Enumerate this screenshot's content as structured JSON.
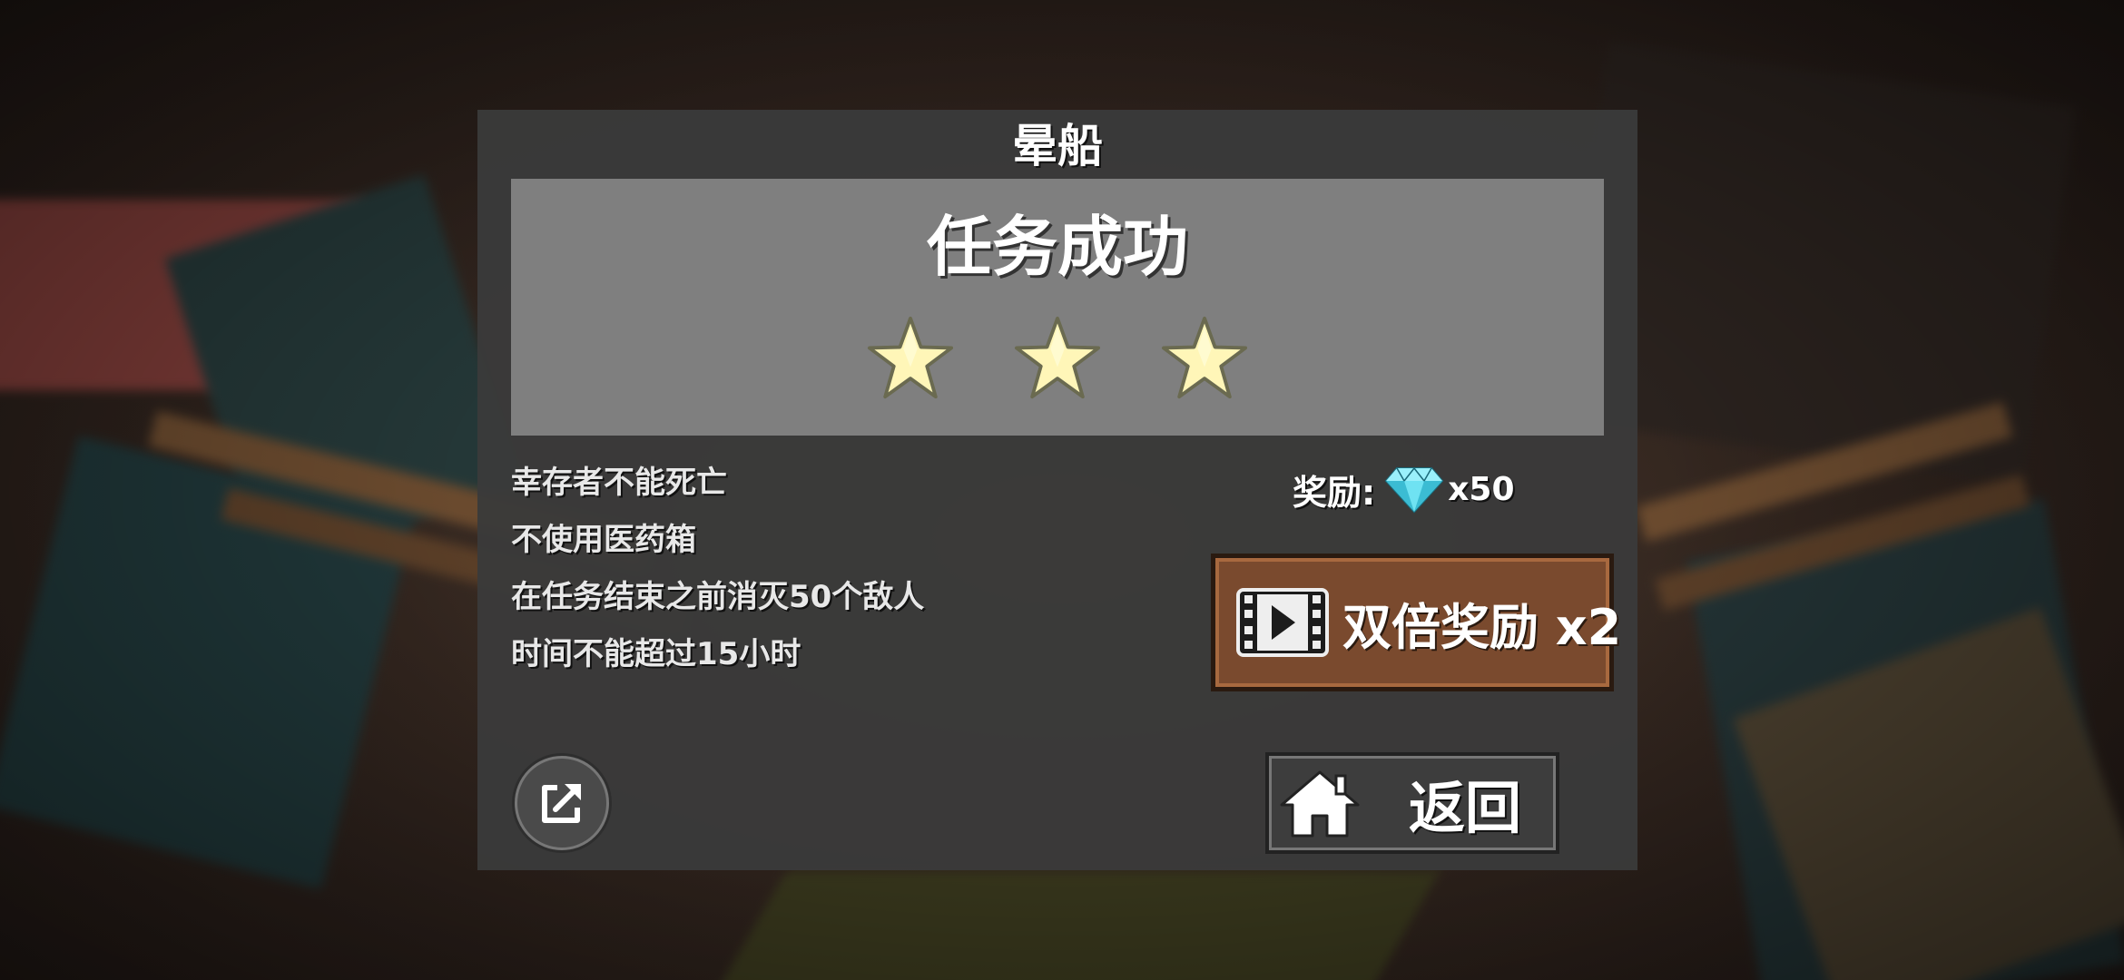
{
  "dialog": {
    "title": "晕船",
    "result_title": "任务成功",
    "stars_earned": 3,
    "stars_total": 3,
    "objectives": [
      "幸存者不能死亡",
      "不使用医药箱",
      "在任务结束之前消灭50个敌人",
      "时间不能超过15小时"
    ],
    "reward": {
      "label": "奖励:",
      "icon": "diamond-icon",
      "amount": "x50"
    },
    "double_reward_button": {
      "label": "双倍奖励 x2",
      "icon": "video-film-icon"
    },
    "share_button": {
      "icon": "share-external-icon"
    },
    "back_button": {
      "label": "返回",
      "icon": "home-icon"
    }
  },
  "colors": {
    "dialog_bg": "#3a3a3a",
    "banner_bg": "#7f7f7f",
    "star_fill": "#fff6b8",
    "gem": "#4fd3e6",
    "double_button": "#7a4a2e"
  }
}
